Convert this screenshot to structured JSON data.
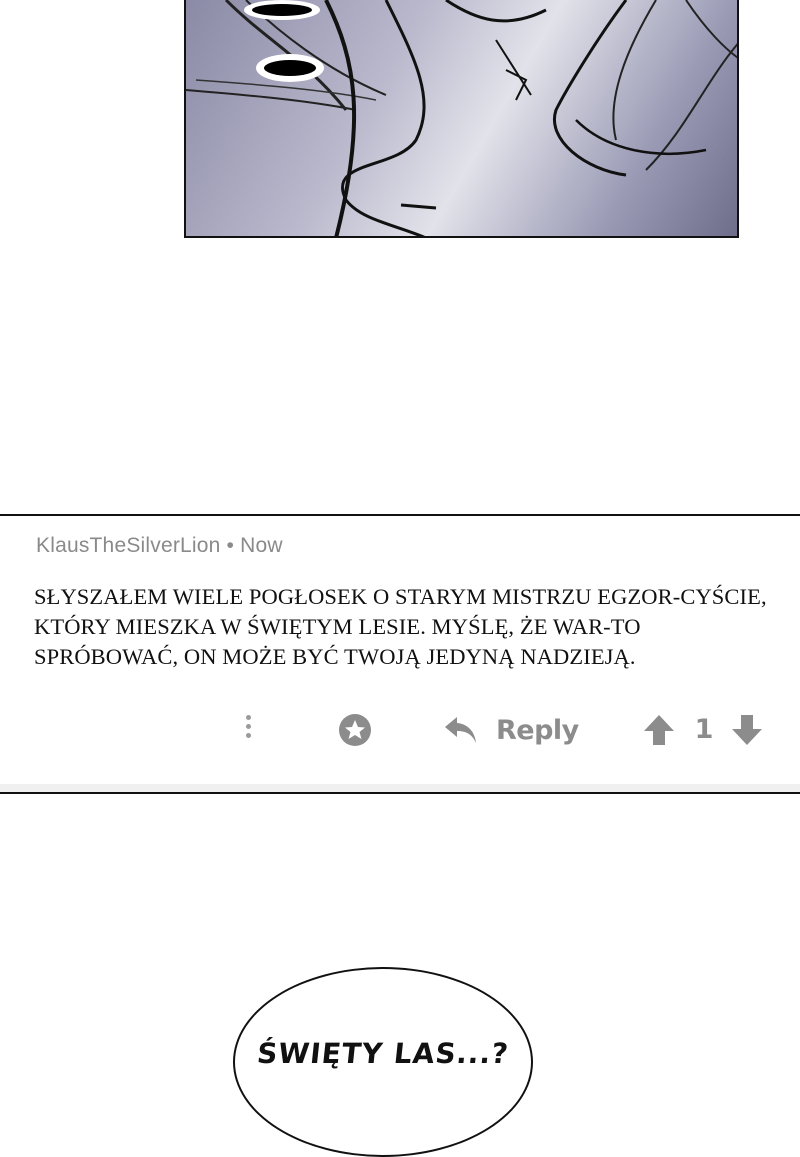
{
  "comment": {
    "author": "KlausTheSilverLion",
    "separator": "•",
    "time": "Now",
    "text": "SŁYSZAŁEM WIELE POGŁOSEK O STARYM MISTRZU EGZOR-CYŚCIE, KTÓRY MIESZKA W ŚWIĘTYM LESIE. MYŚLĘ, ŻE WAR-TO SPRÓBOWAĆ, ON MOŻE BYĆ TWOJĄ JEDYNĄ NADZIEJĄ.",
    "reply_label": "Reply",
    "vote_count": "1"
  },
  "icons": {
    "more": "more-vertical-icon",
    "star": "star-icon",
    "reply": "reply-arrow-icon",
    "upvote": "upvote-arrow-icon",
    "downvote": "downvote-arrow-icon"
  },
  "speech_bubble": {
    "text": "ŚWIĘTY LAS...?"
  },
  "colors": {
    "meta_text": "#8a8a8a",
    "action_gray": "#8c8c8c",
    "comment_text": "#111111",
    "border": "#111111"
  }
}
